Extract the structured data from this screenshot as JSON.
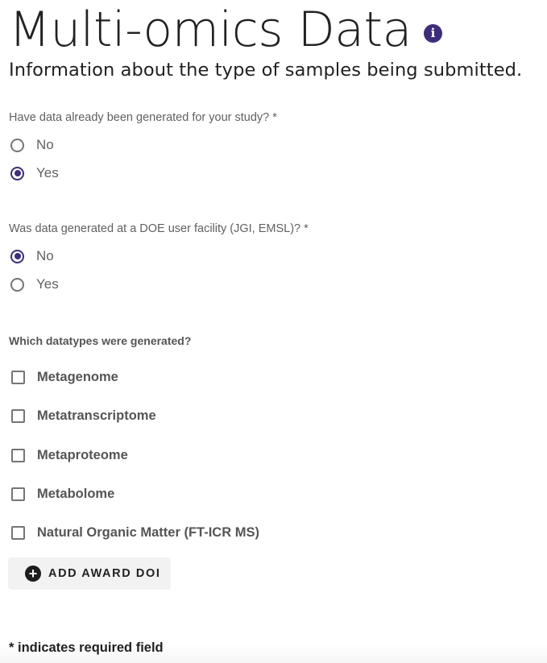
{
  "header": {
    "title": "Multi-omics Data",
    "subtitle": "Information about the type of samples being submitted.",
    "info_icon": "info-icon",
    "info_glyph": "i"
  },
  "questions": [
    {
      "label": "Have data already been generated for your study? *",
      "type": "radio",
      "options": [
        {
          "label": "No",
          "checked": false
        },
        {
          "label": "Yes",
          "checked": true
        }
      ]
    },
    {
      "label": "Was data generated at a DOE user facility (JGI, EMSL)? *",
      "type": "radio",
      "options": [
        {
          "label": "No",
          "checked": true
        },
        {
          "label": "Yes",
          "checked": false
        }
      ]
    },
    {
      "label": "Which datatypes were generated?",
      "type": "checkbox",
      "options": [
        {
          "label": "Metagenome",
          "checked": false
        },
        {
          "label": "Metatranscriptome",
          "checked": false
        },
        {
          "label": "Metaproteome",
          "checked": false
        },
        {
          "label": "Metabolome",
          "checked": false
        },
        {
          "label": "Natural Organic Matter (FT-ICR MS)",
          "checked": false
        }
      ]
    }
  ],
  "award_button": {
    "label": "ADD AWARD DOI",
    "icon": "plus-circle-icon",
    "glyph": "+"
  },
  "footer": {
    "required_note": "* indicates required field"
  },
  "colors": {
    "accent": "#3d2d7a",
    "text": "#212121",
    "muted": "#616161",
    "button_bg": "#f2f2f2"
  }
}
